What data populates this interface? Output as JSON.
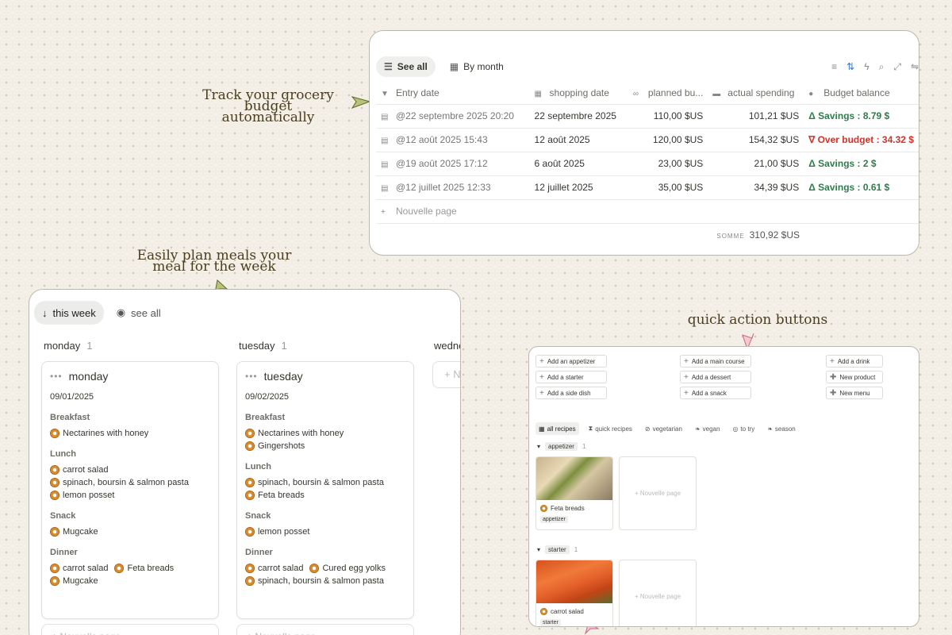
{
  "annotations": {
    "grocery": [
      "Track your grocery",
      "budget automatically"
    ],
    "meals": [
      "Easily plan meals your",
      "meal for the week"
    ],
    "quick": "quick action buttons"
  },
  "grocery": {
    "tabs": [
      {
        "label": "See all",
        "icon": "list-icon",
        "active": true
      },
      {
        "label": "By month",
        "icon": "calendar-icon",
        "active": false
      }
    ],
    "columns": [
      "Entry date",
      "shopping date",
      "planned bu...",
      "actual spending",
      "Budget balance"
    ],
    "rows": [
      {
        "entry": "@22 septembre 2025 20:20",
        "shopping": "22 septembre 2025",
        "planned": "110,00 $US",
        "actual": "101,21 $US",
        "balance": "Δ Savings : 8.79 $",
        "status": "pos"
      },
      {
        "entry": "@12 août 2025 15:43",
        "shopping": "12 août 2025",
        "planned": "120,00 $US",
        "actual": "154,32 $US",
        "balance": "∇ Over budget : 34.32 $",
        "status": "neg"
      },
      {
        "entry": "@19 août 2025 17:12",
        "shopping": "6 août 2025",
        "planned": "23,00 $US",
        "actual": "21,00 $US",
        "balance": "Δ Savings : 2 $",
        "status": "pos"
      },
      {
        "entry": "@12 juillet 2025 12:33",
        "shopping": "12 juillet 2025",
        "planned": "35,00 $US",
        "actual": "34,39 $US",
        "balance": "Δ Savings : 0.61 $",
        "status": "pos"
      }
    ],
    "new_page": "Nouvelle page",
    "sum_label": "SOMME",
    "sum_value": "310,92 $US"
  },
  "meals": {
    "tabs": [
      {
        "label": "this week",
        "icon": "arrow-down-icon",
        "active": true
      },
      {
        "label": "see all",
        "icon": "eye-icon",
        "active": false
      }
    ],
    "columns": [
      {
        "label": "monday",
        "count": "1"
      },
      {
        "label": "tuesday",
        "count": "1"
      },
      {
        "label": "wedne",
        "count": ""
      }
    ],
    "monday": {
      "title": "monday",
      "date": "09/01/2025",
      "breakfast_label": "Breakfast",
      "breakfast": [
        "Nectarines with honey"
      ],
      "lunch_label": "Lunch",
      "lunch": [
        "carrot salad",
        "spinach, boursin & salmon pasta",
        "lemon posset"
      ],
      "snack_label": "Snack",
      "snack": [
        "Mugcake"
      ],
      "dinner_label": "Dinner",
      "dinner": [
        "carrot salad",
        "Feta breads",
        "Mugcake"
      ]
    },
    "tuesday": {
      "title": "tuesday",
      "date": "09/02/2025",
      "breakfast_label": "Breakfast",
      "breakfast": [
        "Nectarines with honey",
        "Gingershots"
      ],
      "lunch_label": "Lunch",
      "lunch": [
        "spinach, boursin & salmon pasta",
        "Feta breads"
      ],
      "snack_label": "Snack",
      "snack": [
        "lemon posset"
      ],
      "dinner_label": "Dinner",
      "dinner": [
        "carrot salad",
        "Cured egg yolks",
        "spinach, boursin & salmon pasta"
      ]
    },
    "stub_label": "+ N",
    "new_page": "+ Nouvelle page"
  },
  "recipes": {
    "quick_buttons": {
      "col1": [
        "Add an appetizer",
        "Add a starter",
        "Add a side dish"
      ],
      "col2": [
        "Add a main course",
        "Add a dessert",
        "Add a snack"
      ],
      "col3": [
        "Add a drink",
        "New product",
        "New menu"
      ]
    },
    "tabs": [
      "all recipes",
      "quick recipes",
      "vegetarian",
      "vegan",
      "to try",
      "season"
    ],
    "groups": [
      {
        "label": "appetizer",
        "count": "1",
        "card": {
          "name": "Feta breads",
          "tag": "appetizer"
        }
      },
      {
        "label": "starter",
        "count": "1",
        "card": {
          "name": "carrot salad",
          "tag": "starter"
        }
      }
    ],
    "new_page": "+ Nouvelle page"
  }
}
